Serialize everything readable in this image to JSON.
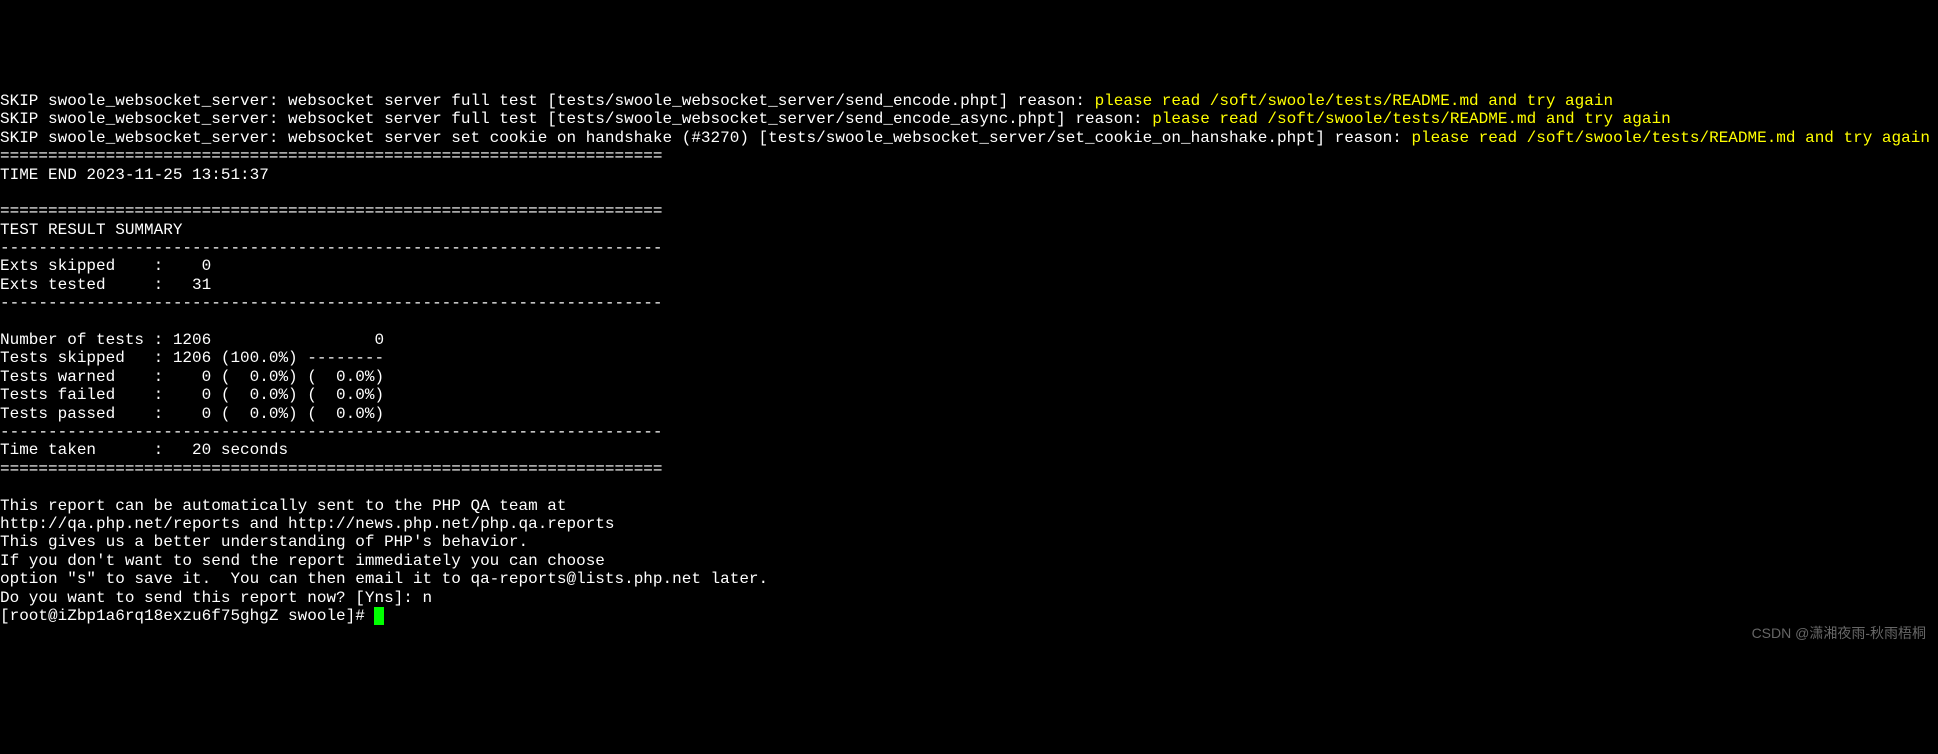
{
  "skip_lines": [
    {
      "prefix": "SKIP swoole_websocket_server: websocket server full test [tests/swoole_websocket_server/send_encode.phpt] reason: ",
      "reason": "please read /soft/swoole/tests/README.md and try again"
    },
    {
      "prefix": "SKIP swoole_websocket_server: websocket server full test [tests/swoole_websocket_server/send_encode_async.phpt] reason: ",
      "reason": "please read /soft/swoole/tests/README.md and try again"
    },
    {
      "prefix": "SKIP swoole_websocket_server: websocket server set cookie on handshake (#3270) [tests/swoole_websocket_server/set_cookie_on_hanshake.phpt] reason: ",
      "reason": "please read /soft/swoole/tests/README.md and try again"
    }
  ],
  "divider_eq": "=====================================================================",
  "divider_dash": "---------------------------------------------------------------------",
  "time_end": "TIME END 2023-11-25 13:51:37",
  "summary_header": "TEST RESULT SUMMARY",
  "exts_skipped": "Exts skipped    :    0",
  "exts_tested": "Exts tested     :   31",
  "num_tests": "Number of tests : 1206                 0",
  "tests_skipped": "Tests skipped   : 1206 (100.0%) --------",
  "tests_warned": "Tests warned    :    0 (  0.0%) (  0.0%)",
  "tests_failed": "Tests failed    :    0 (  0.0%) (  0.0%)",
  "tests_passed": "Tests passed    :    0 (  0.0%) (  0.0%)",
  "time_taken": "Time taken      :   20 seconds",
  "report": {
    "l1": "This report can be automatically sent to the PHP QA team at",
    "l2": "http://qa.php.net/reports and http://news.php.net/php.qa.reports",
    "l3": "This gives us a better understanding of PHP's behavior.",
    "l4": "If you don't want to send the report immediately you can choose",
    "l5": "option \"s\" to save it.  You can then email it to qa-reports@lists.php.net later.",
    "l6": "Do you want to send this report now? [Yns]: n"
  },
  "prompt": "[root@iZbp1a6rq18exzu6f75ghgZ swoole]# ",
  "watermark": "CSDN @潇湘夜雨-秋雨梧桐"
}
